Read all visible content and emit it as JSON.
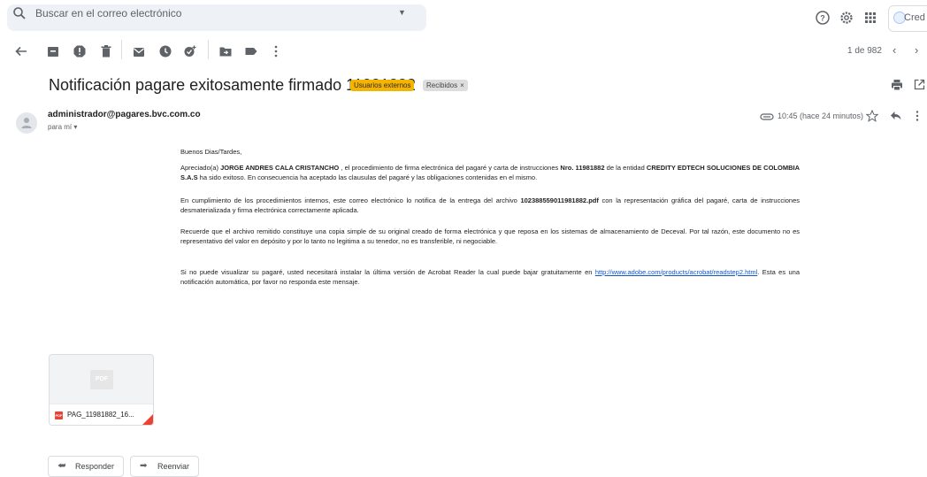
{
  "search": {
    "placeholder": "Buscar en el correo electrónico"
  },
  "topbar": {
    "account_label": "Cred"
  },
  "toolbar": {
    "pager_text": "1 de 982"
  },
  "email": {
    "subject": "Notificación pagare exitosamente firmado 11981882",
    "labels": {
      "external": "Usuarios externos",
      "inbox": "Recibidos",
      "inbox_remove": "×"
    },
    "sender": "administrador@pagares.bvc.com.co",
    "to": "para mí",
    "time": "10:45 (hace 24 minutos)",
    "body": {
      "greeting": "Buenos Dias/Tardes,",
      "p1_a": "Apreciado(a) ",
      "p1_name": "JORGE ANDRES CALA CRISTANCHO",
      "p1_b": " , el procedimiento de firma electrónica del pagaré y carta de instrucciones ",
      "p1_nro": "Nro. 11981882",
      "p1_c": " de la entidad ",
      "p1_entity": "CREDITY EDTECH SOLUCIONES DE COLOMBIA S.A.S",
      "p1_d": " ha sido exitoso. En consecuencia ha aceptado las clausulas del pagaré y las obligaciones contenidas en el mismo.",
      "p2_a": "En cumplimiento de los procedimientos internos, este correo electrónico lo notifica de la entrega del archivo ",
      "p2_file": "102388559011981882.pdf",
      "p2_b": " con la representación gráfica del pagaré, carta de instrucciones desmaterializada y firma electrónica correctamente aplicada.",
      "p3": "Recuerde que el archivo remitido constituye una copia simple de su original creado de forma electrónica y que reposa en los sistemas de almacenamiento de Deceval. Por tal razón, este documento no es representativo del valor en depósito y por lo tanto no legitima a su tenedor, no es transferible, ni negociable.",
      "p4_a": "Si no puede visualizar su pagaré, usted necesitará instalar la última versión de Acrobat Reader la cual puede bajar gratuitamente en ",
      "p4_link": "http://www.adobe.com/products/acrobat/readstep2.html",
      "p4_b": ". Esta es una notificación automática, por favor no responda este mensaje."
    },
    "attachment": {
      "thumb_label": "PDF",
      "badge": "PDF",
      "name": "PAG_11981882_16..."
    },
    "actions": {
      "reply": "Responder",
      "forward": "Reenviar"
    }
  },
  "colors": {
    "accent_link": "#1155cc",
    "label_external": "#f5b400",
    "pdf_red": "#ea4335"
  }
}
